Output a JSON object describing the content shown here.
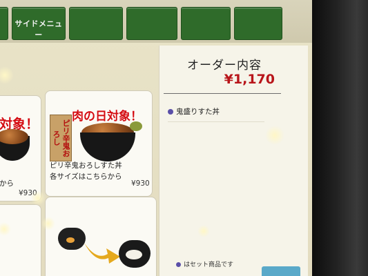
{
  "tabs": [
    {
      "label": ""
    },
    {
      "label": "サイドメニュー"
    },
    {
      "label": ""
    },
    {
      "label": ""
    },
    {
      "label": ""
    },
    {
      "label": ""
    }
  ],
  "menu": {
    "left_card": {
      "badge": "対象！",
      "desc": "から",
      "price": "¥930"
    },
    "main_card": {
      "badge": "肉の日対象！",
      "tag": "ピリ辛鬼おろし",
      "line1": "ピリ辛鬼おろしすた丼",
      "line2": "各サイズはこちらから",
      "price": "¥930"
    }
  },
  "order": {
    "title": "オーダー内容",
    "total": "¥1,170",
    "items": [
      {
        "name": "鬼盛りすた丼"
      }
    ],
    "note": "はセット商品です"
  },
  "colors": {
    "tab_green": "#2f6b2a",
    "accent_red": "#d40d12",
    "bullet_purple": "#5a4fa8"
  }
}
